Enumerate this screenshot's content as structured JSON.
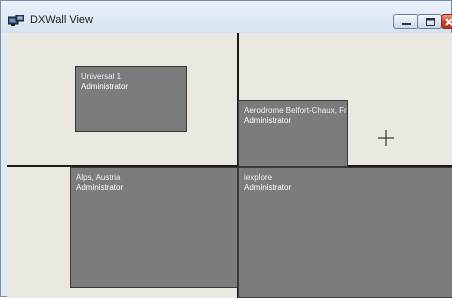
{
  "window": {
    "title": "DXWall View",
    "app_icon": "dxwall-app-icon",
    "controls": [
      "minimize-icon",
      "maximize-icon",
      "close-icon"
    ],
    "colors": {
      "client_background": "#ebe8e1",
      "grid_lines": "#1a1a1a",
      "tile_fill": "#7c7c7c",
      "close_button": "#c0402a"
    }
  },
  "wall": {
    "tiles": [
      {
        "name": "Universal   1",
        "user": "Administrator"
      },
      {
        "name": "Aerodrome Belfort-Chaux, Fr",
        "user": "Administrator"
      },
      {
        "name": "Alps, Austria",
        "user": "Administrator"
      },
      {
        "name": "iexplore",
        "user": "Administrator"
      }
    ],
    "cursor": "crosshair-cursor-icon"
  }
}
